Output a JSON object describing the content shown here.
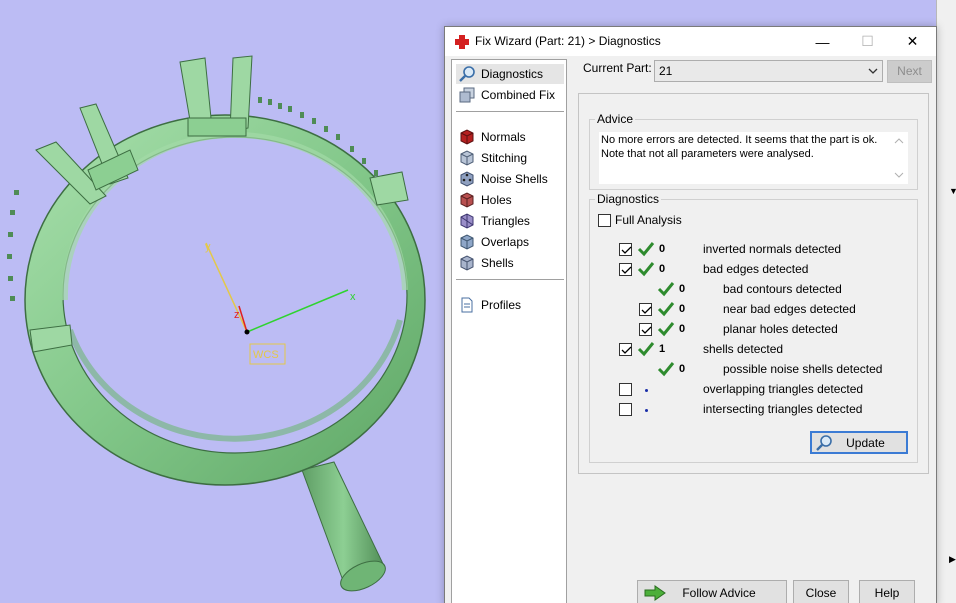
{
  "viewport": {
    "wcs_label": "WCS",
    "axis_x": "x",
    "axis_y": "y",
    "axis_z": "z"
  },
  "window": {
    "title": "Fix Wizard (Part: 21) > Diagnostics",
    "minimize": "—",
    "maximize": "☐",
    "close": "✕"
  },
  "nav": {
    "items": [
      {
        "label": "Diagnostics",
        "icon": "magnifier-icon"
      },
      {
        "label": "Combined Fix",
        "icon": "stacked-cubes-icon"
      },
      {
        "label": "Normals",
        "icon": "red-cube-icon"
      },
      {
        "label": "Stitching",
        "icon": "stitching-cube-icon"
      },
      {
        "label": "Noise Shells",
        "icon": "dice-icon"
      },
      {
        "label": "Holes",
        "icon": "hole-cube-icon"
      },
      {
        "label": "Triangles",
        "icon": "triangle-cube-icon"
      },
      {
        "label": "Overlaps",
        "icon": "overlap-cube-icon"
      },
      {
        "label": "Shells",
        "icon": "shells-cube-icon"
      },
      {
        "label": "Profiles",
        "icon": "document-icon"
      }
    ]
  },
  "current_part": {
    "label": "Current Part:",
    "value": "21"
  },
  "next_label": "Next",
  "advice": {
    "title": "Advice",
    "line1": "No more errors are detected. It seems that the part is ok.",
    "line2": "Note that not all parameters were analysed."
  },
  "diagnostics": {
    "title": "Diagnostics",
    "full_analysis": "Full Analysis",
    "rows": [
      {
        "count": "0",
        "label": "inverted normals detected"
      },
      {
        "count": "0",
        "label": "bad edges detected"
      },
      {
        "count": "0",
        "label": "bad contours detected"
      },
      {
        "count": "0",
        "label": "near bad edges detected"
      },
      {
        "count": "0",
        "label": "planar holes detected"
      },
      {
        "count": "1",
        "label": "shells detected"
      },
      {
        "count": "0",
        "label": "possible noise shells detected"
      },
      {
        "count": "",
        "label": "overlapping triangles detected"
      },
      {
        "count": "",
        "label": "intersecting triangles detected"
      }
    ]
  },
  "buttons": {
    "update": "Update",
    "follow_advice": "Follow Advice",
    "close": "Close",
    "help": "Help"
  },
  "colors": {
    "viewport_bg": "#bcbcf4",
    "model": "#8ccf92",
    "accent": "#3b7bd4",
    "check": "#2e8b2e"
  }
}
